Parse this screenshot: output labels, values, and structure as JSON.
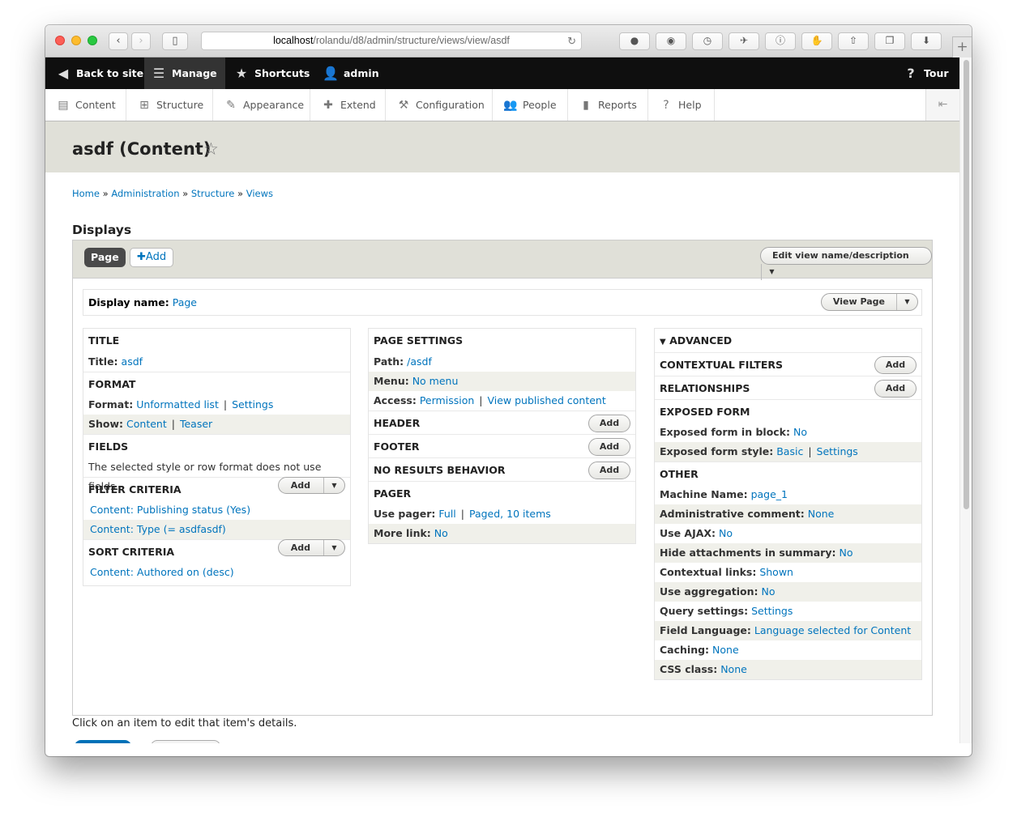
{
  "browser": {
    "url_host": "localhost",
    "url_path": "/rolandu/d8/admin/structure/views/view/asdf",
    "back_icon": "chevron-left-icon",
    "forward_icon": "chevron-right-icon",
    "sidebar_icon": "sidebar-icon",
    "reload_icon": "reload-icon"
  },
  "toolbar": {
    "back_to_site": "Back to site",
    "manage": "Manage",
    "shortcuts": "Shortcuts",
    "user": "admin",
    "tour": "Tour"
  },
  "tray": {
    "items": [
      "Content",
      "Structure",
      "Appearance",
      "Extend",
      "Configuration",
      "People",
      "Reports",
      "Help"
    ]
  },
  "page": {
    "title": "asdf (Content)",
    "breadcrumb": [
      "Home",
      "Administration",
      "Structure",
      "Views"
    ],
    "breadcrumb_sep": "»",
    "displays_heading": "Displays",
    "footer_hint": "Click on an item to edit that item's details."
  },
  "displays": {
    "active_tab": "Page",
    "add_label": "Add",
    "edit_view": "Edit view name/description",
    "display_name_label": "Display name:",
    "display_name_value": "Page",
    "view_page": "View Page"
  },
  "col1": {
    "title_h": "TITLE",
    "title_label": "Title:",
    "title_value": "asdf",
    "format_h": "FORMAT",
    "format_label": "Format:",
    "format_value": "Unformatted list",
    "format_settings": "Settings",
    "show_label": "Show:",
    "show_value": "Content",
    "show_teaser": "Teaser",
    "fields_h": "FIELDS",
    "fields_note": "The selected style or row format does not use fields.",
    "filter_h": "FILTER CRITERIA",
    "filter_items": [
      "Content: Publishing status (Yes)",
      "Content: Type (= asdfasdf)"
    ],
    "sort_h": "SORT CRITERIA",
    "sort_items": [
      "Content: Authored on (desc)"
    ],
    "add": "Add"
  },
  "col2": {
    "page_settings_h": "PAGE SETTINGS",
    "path_label": "Path:",
    "path_value": "/asdf",
    "menu_label": "Menu:",
    "menu_value": "No menu",
    "access_label": "Access:",
    "access_value": "Permission",
    "access_value2": "View published content",
    "header_h": "HEADER",
    "footer_h": "FOOTER",
    "noresults_h": "NO RESULTS BEHAVIOR",
    "pager_h": "PAGER",
    "use_pager_label": "Use pager:",
    "use_pager_value": "Full",
    "use_pager_value2": "Paged, 10 items",
    "more_link_label": "More link:",
    "more_link_value": "No",
    "add": "Add"
  },
  "col3": {
    "advanced_h": "ADVANCED",
    "contextual_h": "CONTEXTUAL FILTERS",
    "relationships_h": "RELATIONSHIPS",
    "exposed_h": "EXPOSED FORM",
    "exposed_block_label": "Exposed form in block:",
    "exposed_block_value": "No",
    "exposed_style_label": "Exposed form style:",
    "exposed_style_value": "Basic",
    "exposed_style_settings": "Settings",
    "other_h": "OTHER",
    "rows": [
      {
        "label": "Machine Name:",
        "value": "page_1"
      },
      {
        "label": "Administrative comment:",
        "value": "None"
      },
      {
        "label": "Use AJAX:",
        "value": "No"
      },
      {
        "label": "Hide attachments in summary:",
        "value": "No"
      },
      {
        "label": "Contextual links:",
        "value": "Shown"
      },
      {
        "label": "Use aggregation:",
        "value": "No"
      },
      {
        "label": "Query settings:",
        "value": "Settings"
      },
      {
        "label": "Field Language:",
        "value": "Language selected for Content"
      },
      {
        "label": "Caching:",
        "value": "None"
      },
      {
        "label": "CSS class:",
        "value": "None"
      }
    ],
    "add": "Add"
  }
}
